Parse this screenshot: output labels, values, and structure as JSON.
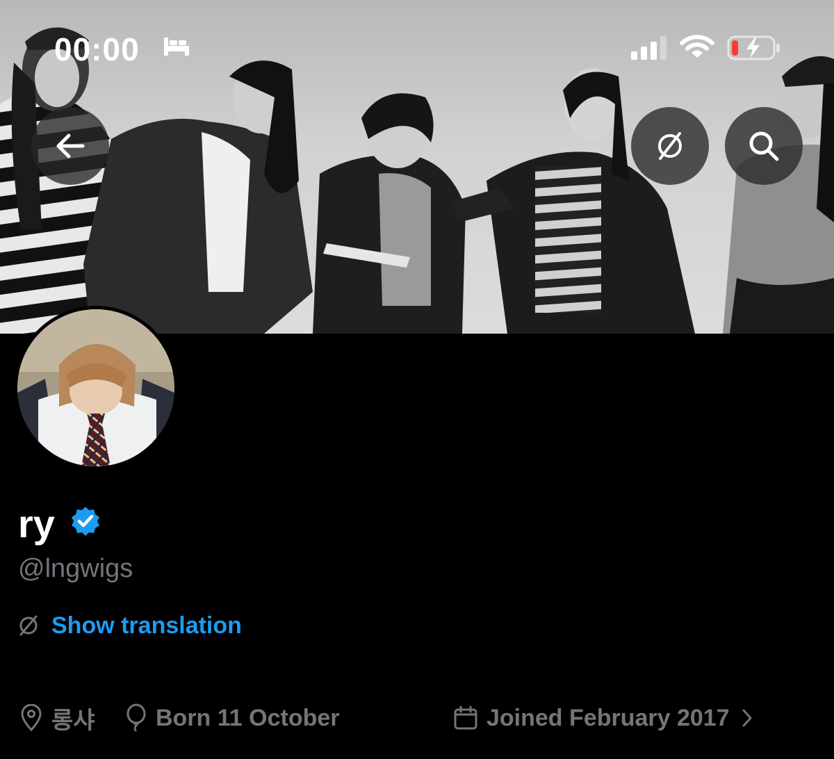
{
  "status_bar": {
    "time": "00:00",
    "icons": [
      "bed-icon",
      "signal-icon",
      "wifi-icon",
      "battery-charging-icon"
    ],
    "battery_color": "#ff3b30"
  },
  "header": {
    "back_icon": "arrow-left-icon",
    "actions": [
      "translate-icon",
      "search-icon"
    ]
  },
  "profile": {
    "display_name": "ry",
    "verified": true,
    "verified_color": "#1d9bf0",
    "handle": "@lngwigs",
    "show_translation_label": "Show translation",
    "location": "롱샤",
    "birthday": "Born 11 October",
    "joined": "Joined February 2017"
  },
  "colors": {
    "background": "#000000",
    "accent": "#1d9bf0",
    "secondary_text": "#71767b"
  }
}
